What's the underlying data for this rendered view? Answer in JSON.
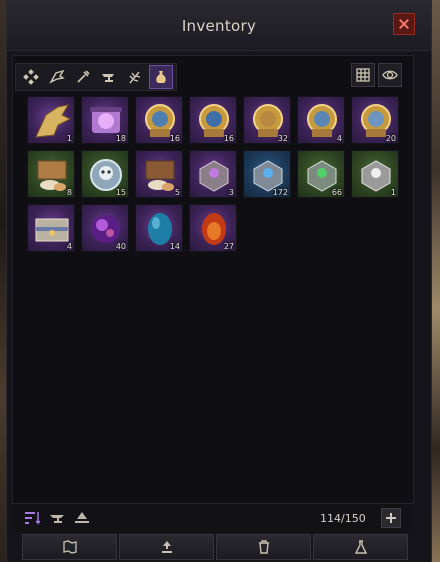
{
  "window": {
    "title": "Inventory",
    "close_icon": "close-icon"
  },
  "tabs": [
    {
      "name": "all-items",
      "icon": "grid-diamond-icon",
      "active": false
    },
    {
      "name": "equipment",
      "icon": "wing-icon",
      "active": false
    },
    {
      "name": "consumables",
      "icon": "potion-icon",
      "active": false
    },
    {
      "name": "crafting",
      "icon": "anvil-icon",
      "active": false
    },
    {
      "name": "materials",
      "icon": "herb-icon",
      "active": false
    },
    {
      "name": "misc",
      "icon": "pouch-icon",
      "active": true
    }
  ],
  "view_controls": [
    {
      "name": "grid-view-button",
      "icon": "grid-view-icon"
    },
    {
      "name": "visibility-button",
      "icon": "eye-icon"
    }
  ],
  "items": [
    {
      "name": "golden-wing",
      "icon": "wing-icon",
      "rarity": "purple",
      "qty": "1"
    },
    {
      "name": "magic-scroll",
      "icon": "scroll-icon",
      "rarity": "purple",
      "qty": "18"
    },
    {
      "name": "coin-chest-a",
      "icon": "chest-coin-icon",
      "rarity": "purple",
      "qty": "16"
    },
    {
      "name": "coin-chest-b",
      "icon": "chest-coin-icon",
      "rarity": "purple",
      "qty": "16"
    },
    {
      "name": "coin-chest-c",
      "icon": "chest-coin-icon",
      "rarity": "purple",
      "qty": "32"
    },
    {
      "name": "coin-chest-d",
      "icon": "chest-coin-icon",
      "rarity": "purple",
      "qty": "4"
    },
    {
      "name": "coin-chest-e",
      "icon": "chest-coin-icon",
      "rarity": "purple",
      "qty": "20"
    },
    {
      "name": "food-box-a",
      "icon": "food-box-icon",
      "rarity": "green",
      "qty": "8"
    },
    {
      "name": "skull-coin",
      "icon": "skull-coin-icon",
      "rarity": "green",
      "qty": "15"
    },
    {
      "name": "food-box-b",
      "icon": "food-box-icon",
      "rarity": "purple",
      "qty": "5"
    },
    {
      "name": "lockbox-purple",
      "icon": "lockbox-icon",
      "rarity": "purple",
      "qty": "3"
    },
    {
      "name": "lockbox-blue",
      "icon": "lockbox-icon",
      "rarity": "blue",
      "qty": "172"
    },
    {
      "name": "lockbox-green",
      "icon": "lockbox-icon",
      "rarity": "green",
      "qty": "66"
    },
    {
      "name": "lockbox-silver",
      "icon": "lockbox-icon",
      "rarity": "green",
      "qty": "1"
    },
    {
      "name": "treasure-chest",
      "icon": "treasure-chest-icon",
      "rarity": "purple",
      "qty": "4"
    },
    {
      "name": "purple-orb",
      "icon": "orb-icon",
      "rarity": "purple",
      "qty": "40"
    },
    {
      "name": "blue-egg",
      "icon": "egg-icon",
      "rarity": "purple",
      "qty": "14"
    },
    {
      "name": "red-egg",
      "icon": "egg-icon",
      "rarity": "purple",
      "qty": "27"
    }
  ],
  "colors": {
    "accent_purple": "#7a4fb0",
    "rarity_purple": "#4b2c6b",
    "rarity_green": "#34502a",
    "rarity_blue": "#24486e"
  },
  "bottom": {
    "sort_icons": [
      "sort-icon",
      "filter-anvil-icon",
      "stack-icon"
    ],
    "capacity": "114/150",
    "add_icon": "plus-icon"
  },
  "actions": [
    {
      "name": "map-button",
      "icon": "map-icon"
    },
    {
      "name": "upgrade-button",
      "icon": "upgrade-icon"
    },
    {
      "name": "delete-button",
      "icon": "trash-icon"
    },
    {
      "name": "alchemy-button",
      "icon": "flask-icon"
    }
  ]
}
